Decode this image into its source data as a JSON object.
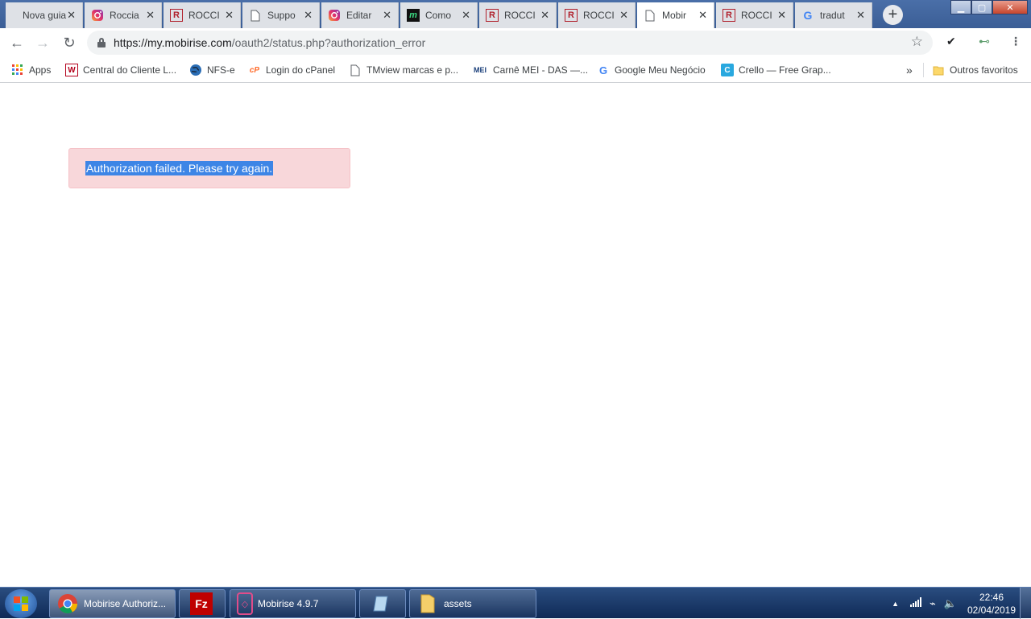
{
  "tabs": [
    {
      "title": "Nova guia",
      "icon": "none",
      "active": false
    },
    {
      "title": "Roccia",
      "icon": "instagram-icon",
      "active": false
    },
    {
      "title": "ROCCI",
      "icon": "rocci-logo-icon",
      "active": false
    },
    {
      "title": "Suppo",
      "icon": "page-icon",
      "active": false
    },
    {
      "title": "Editar",
      "icon": "instagram-icon",
      "active": false
    },
    {
      "title": "Como",
      "icon": "m-logo-icon",
      "active": false
    },
    {
      "title": "ROCCI",
      "icon": "rocci-logo-icon",
      "active": false
    },
    {
      "title": "ROCCI",
      "icon": "rocci-logo-icon",
      "active": false
    },
    {
      "title": "Mobir",
      "icon": "page-icon",
      "active": true
    },
    {
      "title": "ROCCI",
      "icon": "rocci-logo-icon",
      "active": false
    },
    {
      "title": "tradut",
      "icon": "google-icon",
      "active": false
    }
  ],
  "omnibox": {
    "url_host": "https://my.mobirise.com",
    "url_path": "/oauth2/status.php?authorization_error"
  },
  "bookmarks": {
    "apps": "Apps",
    "items": [
      {
        "label": "Central do Cliente L...",
        "icon": "w-logo-icon"
      },
      {
        "label": "NFS-e",
        "icon": "globe-icon"
      },
      {
        "label": "Login do cPanel",
        "icon": "cpanel-icon"
      },
      {
        "label": "TMview marcas e p...",
        "icon": "page-icon"
      },
      {
        "label": "Carnê MEI - DAS —...",
        "icon": "mei-icon"
      },
      {
        "label": "Google Meu Negócio",
        "icon": "google-icon"
      },
      {
        "label": "Crello — Free Grap...",
        "icon": "crello-icon"
      }
    ],
    "overflow": "»",
    "other": "Outros favoritos"
  },
  "content": {
    "alert_message": "Authorization failed. Please try again."
  },
  "taskbar": {
    "items": [
      {
        "label": "Mobirise Authoriz...",
        "icon": "chrome-icon",
        "active": true
      },
      {
        "label": "",
        "icon": "filezilla-icon",
        "active": false
      },
      {
        "label": "Mobirise 4.9.7",
        "icon": "mobirise-icon",
        "active": false
      },
      {
        "label": "",
        "icon": "notepad-icon",
        "active": false
      },
      {
        "label": "assets",
        "icon": "folder-icon",
        "active": false
      }
    ],
    "time": "22:46",
    "date": "02/04/2019"
  },
  "colors": {
    "alert_bg": "#f8d7da",
    "selection": "#3d85e6",
    "taskbar": "#1c3a6b"
  }
}
